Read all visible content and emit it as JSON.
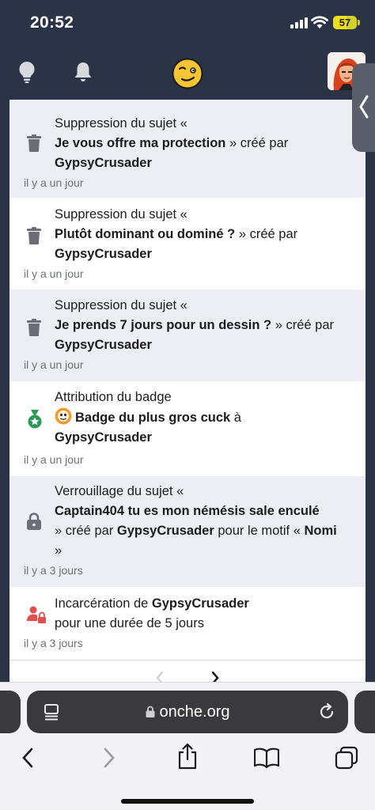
{
  "status": {
    "time": "20:52",
    "battery": "57"
  },
  "header": {
    "avatar_alt": "user avatar"
  },
  "notifications": [
    {
      "title": "Suppression du sujet «",
      "subject": "Je vous offre ma protection",
      "suffix": " » créé par",
      "user": "GypsyCrusader",
      "ago": "il y a un jour"
    },
    {
      "title": "Suppression du sujet «",
      "subject": "Plutôt dominant ou dominé ?",
      "suffix": " » créé par",
      "user": "GypsyCrusader",
      "ago": "il y a un jour"
    },
    {
      "title": "Suppression du sujet «",
      "subject": "Je prends 7 jours pour un dessin ?",
      "suffix": " » créé par",
      "user": "GypsyCrusader",
      "ago": "il y a un jour"
    },
    {
      "title": "Attribution du badge",
      "subject": "Badge du plus gros cuck",
      "suffix": " à",
      "user": "GypsyCrusader",
      "ago": "il y a un jour"
    },
    {
      "title": "Verrouillage du sujet «",
      "subject": "Captain404 tu es mon némésis sale enculé",
      "mid": "» créé par ",
      "user": "GypsyCrusader",
      "reason_prefix": " pour le motif « ",
      "reason": "Nomi",
      "close": "»",
      "ago": "il y a 3 jours"
    },
    {
      "title_prefix": "Incarcération de ",
      "user": "GypsyCrusader",
      "line2": "pour une durée de 5 jours",
      "ago": "il y a 3 jours"
    }
  ],
  "browser": {
    "url": "onche.org"
  },
  "colors": {
    "bg_dark": "#2b3447",
    "row_shaded": "#eceef3",
    "icon_gray": "#6b6e76",
    "badge_green": "#2f9a57",
    "jail_red": "#e04e4e"
  }
}
